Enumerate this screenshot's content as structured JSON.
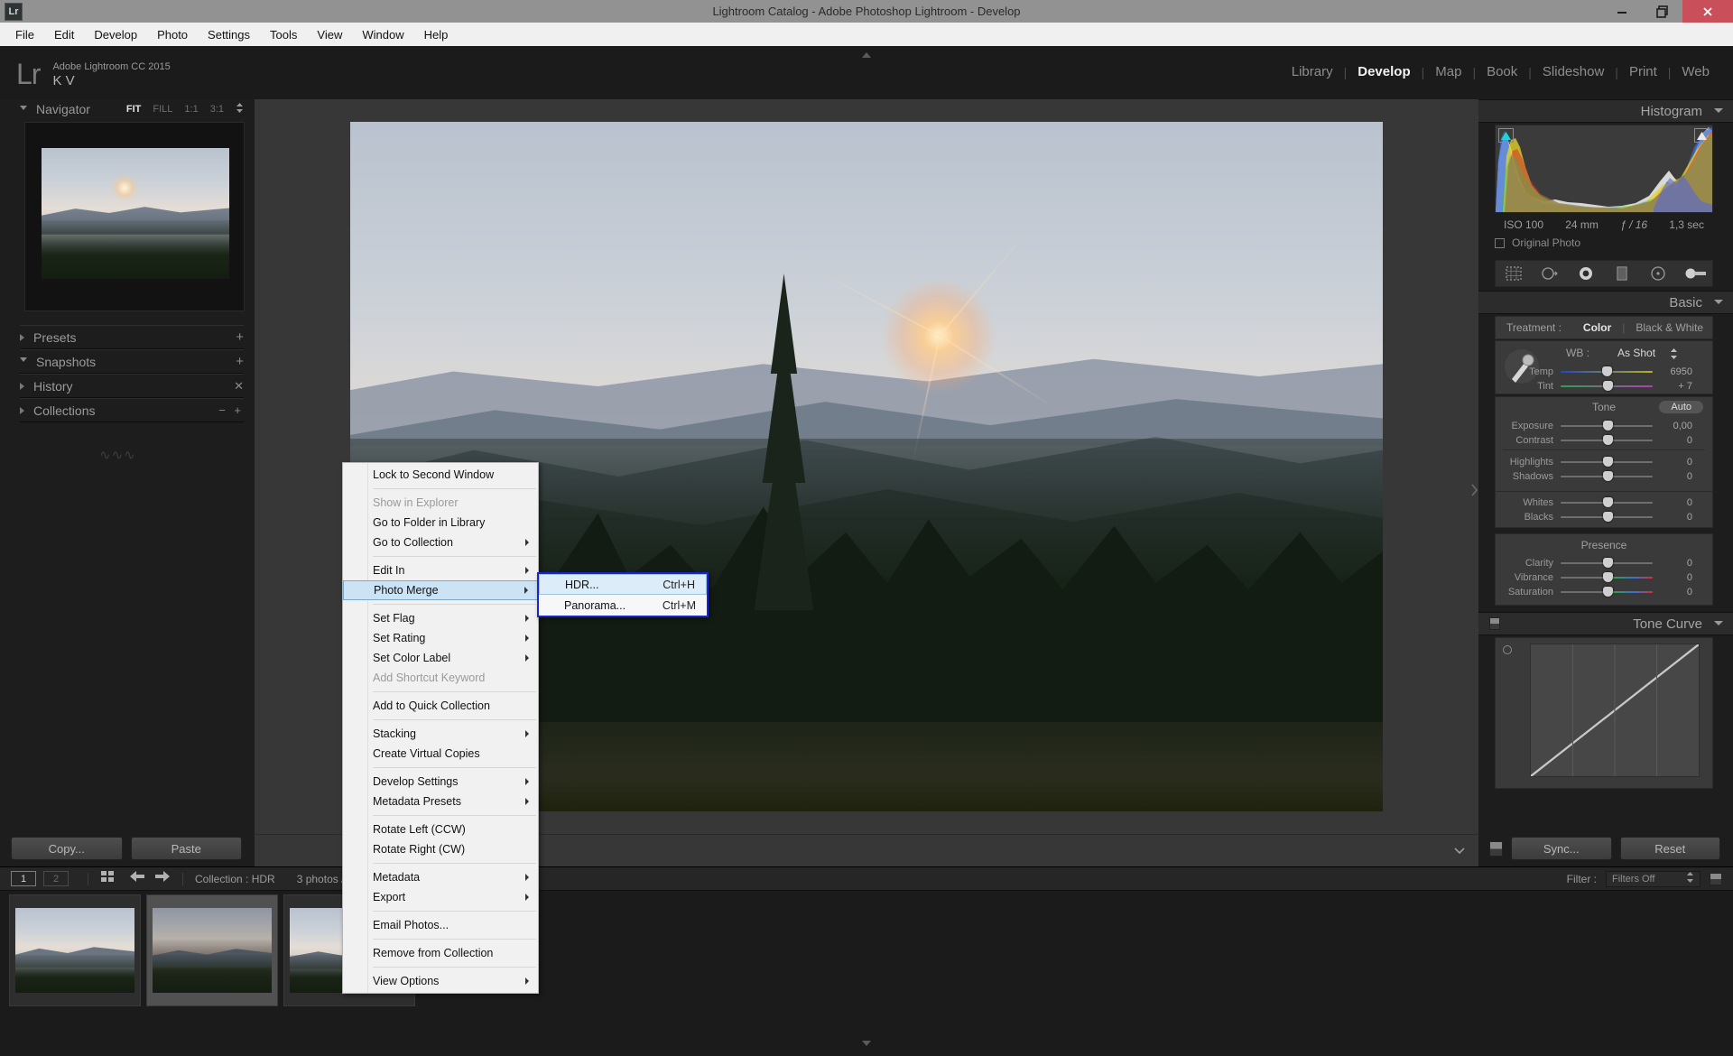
{
  "titlebar": {
    "app_icon": "Lr",
    "title": "Lightroom Catalog - Adobe Photoshop Lightroom - Develop",
    "minimize": "–",
    "maximize": "❐",
    "close": "✕"
  },
  "menubar": {
    "items": [
      "File",
      "Edit",
      "Develop",
      "Photo",
      "Settings",
      "Tools",
      "View",
      "Window",
      "Help"
    ]
  },
  "identity": {
    "logo": "Lr",
    "line1": "Adobe Lightroom CC 2015",
    "line2": "K V"
  },
  "modules": [
    {
      "label": "Library",
      "active": false
    },
    {
      "label": "Develop",
      "active": true
    },
    {
      "label": "Map",
      "active": false
    },
    {
      "label": "Book",
      "active": false
    },
    {
      "label": "Slideshow",
      "active": false
    },
    {
      "label": "Print",
      "active": false
    },
    {
      "label": "Web",
      "active": false
    }
  ],
  "left_panel": {
    "navigator": {
      "title": "Navigator",
      "zoom_levels": [
        {
          "label": "FIT",
          "active": true
        },
        {
          "label": "FILL",
          "active": false
        },
        {
          "label": "1:1",
          "active": false
        },
        {
          "label": "3:1",
          "active": false
        }
      ]
    },
    "sections": [
      {
        "label": "Presets",
        "expanded": false,
        "action": "+"
      },
      {
        "label": "Snapshots",
        "expanded": true,
        "action": "+"
      },
      {
        "label": "History",
        "expanded": false,
        "action": "✕"
      },
      {
        "label": "Collections",
        "expanded": false,
        "action": "− +"
      }
    ],
    "copy_label": "Copy...",
    "paste_label": "Paste"
  },
  "right_panel": {
    "histogram": {
      "title": "Histogram",
      "iso": "ISO 100",
      "focal": "24 mm",
      "aperture": "ƒ / 16",
      "shutter": "1,3 sec",
      "original_photo": "Original Photo"
    },
    "basic": {
      "title": "Basic",
      "treatment_label": "Treatment :",
      "treatment_color": "Color",
      "treatment_bw": "Black & White",
      "wb_label": "WB :",
      "wb_value": "As Shot",
      "sliders": [
        {
          "label": "Temp",
          "value": "6950",
          "pos": 50
        },
        {
          "label": "Tint",
          "value": "+ 7",
          "pos": 52
        }
      ],
      "tone_label": "Tone",
      "auto_label": "Auto",
      "tone_sliders": [
        {
          "label": "Exposure",
          "value": "0,00",
          "pos": 50
        },
        {
          "label": "Contrast",
          "value": "0",
          "pos": 50
        },
        {
          "label": "Highlights",
          "value": "0",
          "pos": 50
        },
        {
          "label": "Shadows",
          "value": "0",
          "pos": 50
        },
        {
          "label": "Whites",
          "value": "0",
          "pos": 50
        },
        {
          "label": "Blacks",
          "value": "0",
          "pos": 50
        }
      ],
      "presence_label": "Presence",
      "presence_sliders": [
        {
          "label": "Clarity",
          "value": "0",
          "pos": 50
        },
        {
          "label": "Vibrance",
          "value": "0",
          "pos": 50
        },
        {
          "label": "Saturation",
          "value": "0",
          "pos": 50
        }
      ]
    },
    "tone_curve_title": "Tone Curve",
    "sync_label": "Sync...",
    "reset_label": "Reset"
  },
  "filmstrip": {
    "page1": "1",
    "page2": "2",
    "collection_label": "Collection : HDR",
    "count_label": "3 photos /3 se",
    "filter_label": "Filter :",
    "filter_value": "Filters Off"
  },
  "context_menu": {
    "items": [
      {
        "label": "Lock to Second Window",
        "type": "item"
      },
      {
        "type": "sep"
      },
      {
        "label": "Show in Explorer",
        "type": "item",
        "disabled": true
      },
      {
        "label": "Go to Folder in Library",
        "type": "item"
      },
      {
        "label": "Go to Collection",
        "type": "item",
        "submenu": true
      },
      {
        "type": "sep"
      },
      {
        "label": "Edit In",
        "type": "item",
        "submenu": true
      },
      {
        "label": "Photo Merge",
        "type": "item",
        "submenu": true,
        "highlighted": true
      },
      {
        "type": "sep"
      },
      {
        "label": "Set Flag",
        "type": "item",
        "submenu": true
      },
      {
        "label": "Set Rating",
        "type": "item",
        "submenu": true
      },
      {
        "label": "Set Color Label",
        "type": "item",
        "submenu": true
      },
      {
        "label": "Add Shortcut Keyword",
        "type": "item",
        "disabled": true
      },
      {
        "type": "sep"
      },
      {
        "label": "Add to Quick Collection",
        "type": "item"
      },
      {
        "type": "sep"
      },
      {
        "label": "Stacking",
        "type": "item",
        "submenu": true
      },
      {
        "label": "Create Virtual Copies",
        "type": "item"
      },
      {
        "type": "sep"
      },
      {
        "label": "Develop Settings",
        "type": "item",
        "submenu": true
      },
      {
        "label": "Metadata Presets",
        "type": "item",
        "submenu": true
      },
      {
        "type": "sep"
      },
      {
        "label": "Rotate Left (CCW)",
        "type": "item"
      },
      {
        "label": "Rotate Right (CW)",
        "type": "item"
      },
      {
        "type": "sep"
      },
      {
        "label": "Metadata",
        "type": "item",
        "submenu": true
      },
      {
        "label": "Export",
        "type": "item",
        "submenu": true
      },
      {
        "type": "sep"
      },
      {
        "label": "Email Photos...",
        "type": "item"
      },
      {
        "type": "sep"
      },
      {
        "label": "Remove from Collection",
        "type": "item"
      },
      {
        "type": "sep"
      },
      {
        "label": "View Options",
        "type": "item",
        "submenu": true
      }
    ]
  },
  "submenu": {
    "items": [
      {
        "label": "HDR...",
        "shortcut": "Ctrl+H",
        "highlighted": true
      },
      {
        "label": "Panorama...",
        "shortcut": "Ctrl+M",
        "highlighted": false
      }
    ]
  },
  "colors": {
    "accent_highlight": "#cce3f5",
    "submenu_border": "#1b23d6",
    "close_button": "#c9505a",
    "panel_bg": "#1d1d1d"
  }
}
